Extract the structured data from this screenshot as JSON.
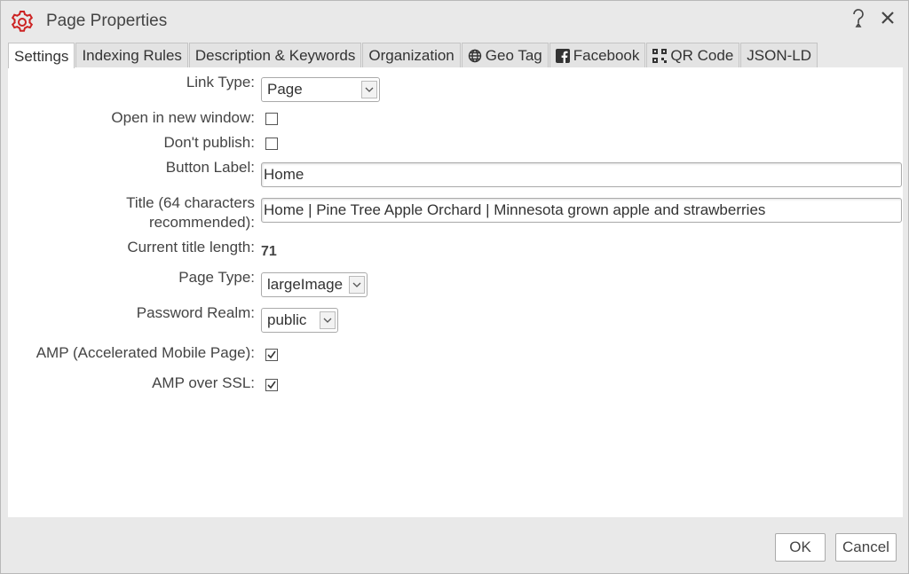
{
  "window": {
    "title": "Page Properties",
    "icons": {
      "app": "gear-icon",
      "help": "help-icon",
      "close": "close-icon"
    }
  },
  "tabs": [
    {
      "label": "Settings",
      "icon": null,
      "active": true
    },
    {
      "label": "Indexing Rules",
      "icon": null,
      "active": false
    },
    {
      "label": "Description & Keywords",
      "icon": null,
      "active": false
    },
    {
      "label": "Organization",
      "icon": null,
      "active": false
    },
    {
      "label": "Geo Tag",
      "icon": "globe-icon",
      "active": false
    },
    {
      "label": "Facebook",
      "icon": "facebook-icon",
      "active": false
    },
    {
      "label": "QR Code",
      "icon": "qr-code-icon",
      "active": false
    },
    {
      "label": "JSON-LD",
      "icon": null,
      "active": false
    }
  ],
  "form": {
    "link_type": {
      "label": "Link Type:",
      "value": "Page"
    },
    "open_new_window": {
      "label": "Open in new window:",
      "checked": false
    },
    "dont_publish": {
      "label": "Don't publish:",
      "checked": false
    },
    "button_label": {
      "label": "Button Label:",
      "value": "Home"
    },
    "title": {
      "label_line1": "Title (64 characters",
      "label_line2": "recommended):",
      "value": "Home | Pine Tree Apple Orchard | Minnesota grown apple and strawberries"
    },
    "current_title_length": {
      "label": "Current title length:",
      "value": "71"
    },
    "page_type": {
      "label": "Page Type:",
      "value": "largeImage"
    },
    "password_realm": {
      "label": "Password Realm:",
      "value": "public"
    },
    "amp": {
      "label": "AMP (Accelerated Mobile Page):",
      "checked": true
    },
    "amp_ssl": {
      "label": "AMP over SSL:",
      "checked": true
    }
  },
  "footer": {
    "ok_label": "OK",
    "cancel_label": "Cancel"
  },
  "colors": {
    "accent": "#cc2222",
    "background": "#e9e9e9",
    "panel": "#ffffff"
  }
}
